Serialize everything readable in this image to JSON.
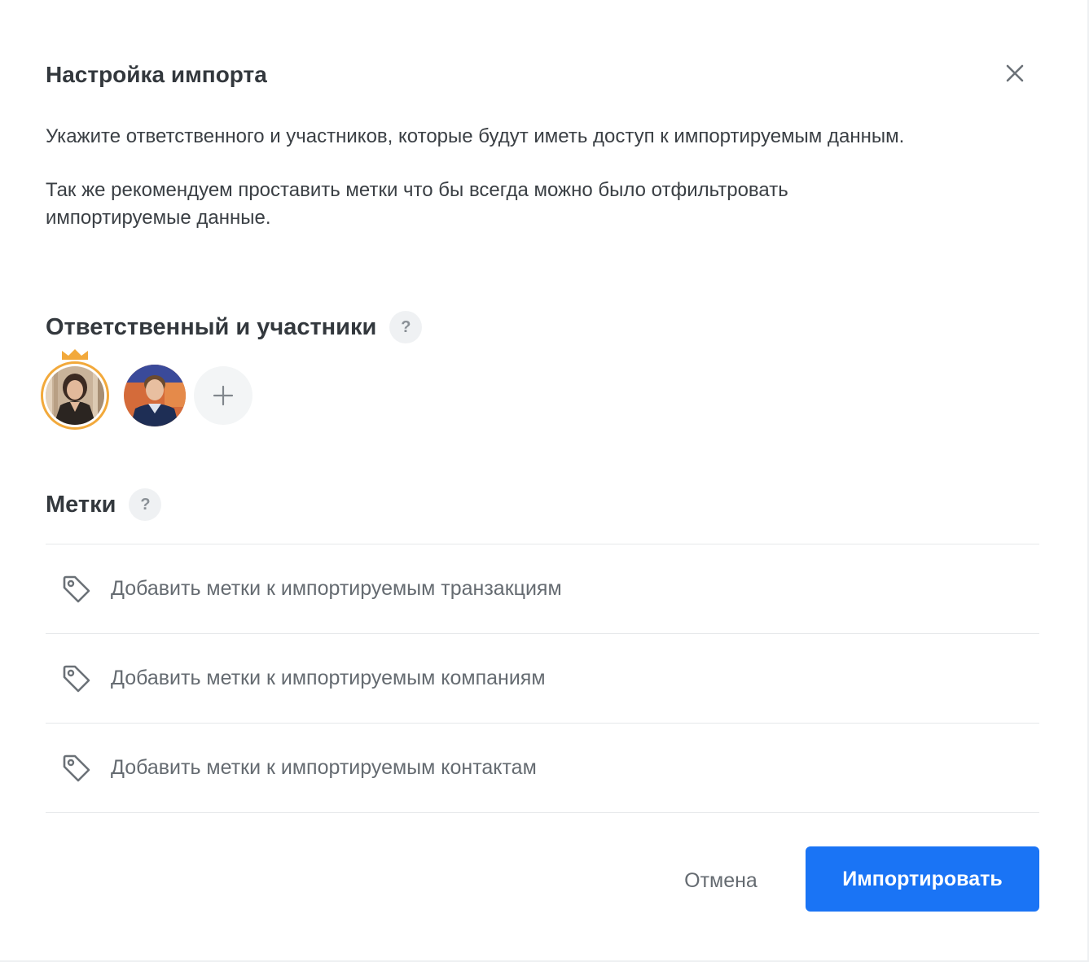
{
  "modal": {
    "title": "Настройка импорта",
    "description_1": "Укажите ответственного и участников, которые будут иметь доступ к импортируемым данным.",
    "description_2": "Так же рекомендуем проставить метки что бы всегда можно было отфильтровать импортируемые данные."
  },
  "participants": {
    "title": "Ответственный и участники",
    "help": "?"
  },
  "tags": {
    "title": "Метки",
    "help": "?",
    "items": [
      {
        "label": "Добавить метки к импортируемым транзакциям",
        "icon": "tag-icon"
      },
      {
        "label": "Добавить метки к импортируемым компаниям",
        "icon": "tag-icon"
      },
      {
        "label": "Добавить метки к импортируемым контактам",
        "icon": "tag-icon"
      }
    ]
  },
  "actions": {
    "cancel": "Отмена",
    "import": "Импортировать"
  },
  "colors": {
    "primary": "#1a74f5",
    "owner_ring": "#f2a93b"
  }
}
